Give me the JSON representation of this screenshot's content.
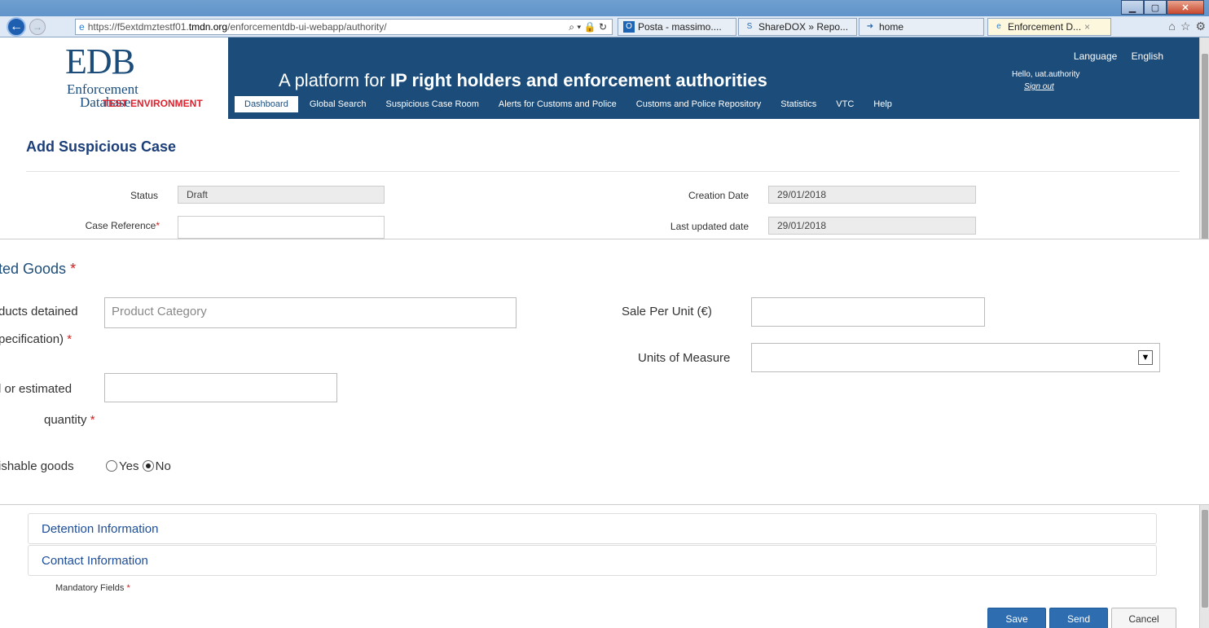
{
  "browser": {
    "url_prefix": "https://f5extdmztestf01.",
    "url_host": "tmdn.org",
    "url_path": "/enforcementdb-ui-webapp/authority/",
    "address_tools": "⌕ ▾ 🔒 ↻",
    "tabs": [
      {
        "label": "Posta - massimo....",
        "icon": "outlook-icon"
      },
      {
        "label": "ShareDOX » Repo...",
        "icon": "sharedox-icon"
      },
      {
        "label": "home",
        "icon": "home-page-icon"
      },
      {
        "label": "Enforcement D...",
        "icon": "ie-icon"
      }
    ],
    "tab_close": "×"
  },
  "header": {
    "logo_main": "EDB",
    "logo_line1": "Enforcement",
    "logo_line2": "Database",
    "test_env": "TEST ENVIRONMENT",
    "tagline_prefix": "A platform for ",
    "tagline_bold": "IP right holders and enforcement authorities",
    "language_label": "Language",
    "language_value": "English",
    "hello": "Hello, uat.authority",
    "sign_out": "Sign out",
    "nav": [
      "Dashboard",
      "Global Search",
      "Suspicious Case Room",
      "Alerts for Customs and Police",
      "Customs and Police Repository",
      "Statistics",
      "VTC",
      "Help"
    ]
  },
  "page": {
    "title": "Add Suspicious Case",
    "status_label": "Status",
    "status_value": "Draft",
    "case_ref_label": "Case Reference",
    "creation_date_label": "Creation Date",
    "creation_date_value": "29/01/2018",
    "last_updated_label": "Last updated date",
    "last_updated_value": "29/01/2018",
    "required_mark": "*"
  },
  "goods": {
    "title": "ted Goods",
    "products_line1": "ducts detained",
    "products_line2": "pecification)",
    "product_category_placeholder": "Product Category",
    "quantity_line1": "l or estimated",
    "quantity_line2": "quantity",
    "perishable_label": "ishable goods",
    "yes_label": "Yes",
    "no_label": "No",
    "perishable_selected": "No",
    "sale_per_unit_label": "Sale Per Unit (€)",
    "units_label": "Units of Measure"
  },
  "sections": {
    "detention": "Detention Information",
    "contact": "Contact Information",
    "mandatory_fields": "Mandatory Fields"
  },
  "actions": {
    "save": "Save",
    "send": "Send",
    "cancel": "Cancel"
  }
}
